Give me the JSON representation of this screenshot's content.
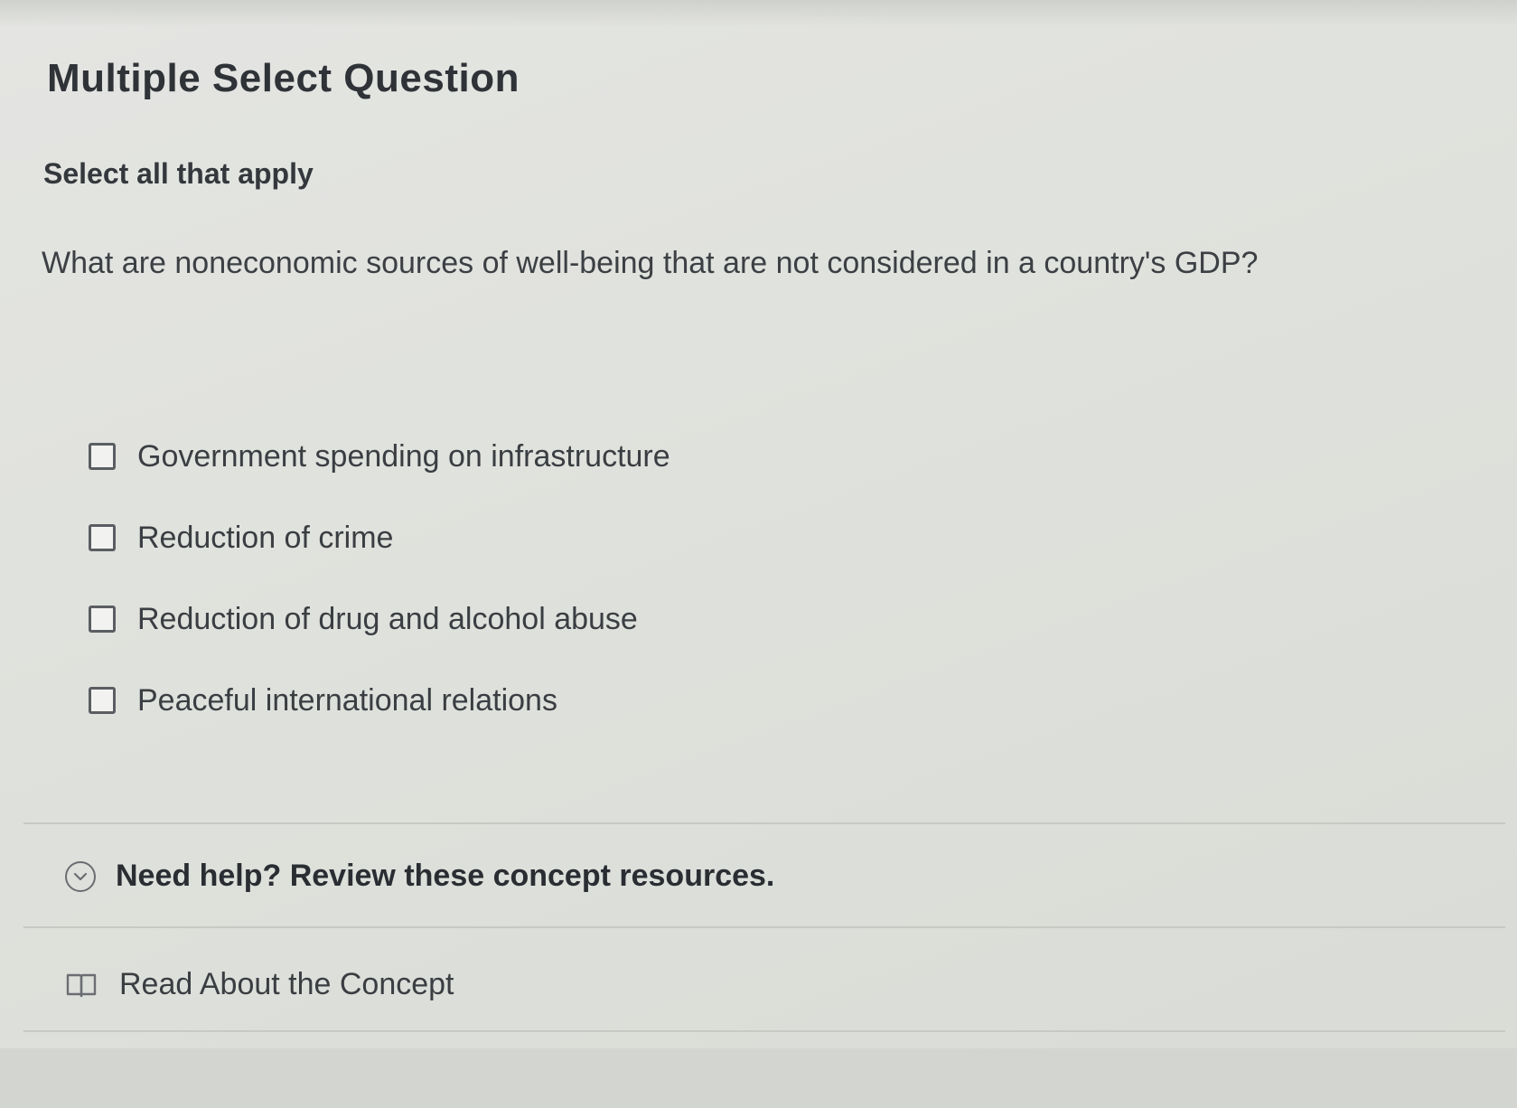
{
  "question": {
    "type_label": "Multiple Select Question",
    "instruction": "Select all that apply",
    "prompt": "What are noneconomic sources of well-being that are not considered in a country's GDP?"
  },
  "options": [
    {
      "label": "Government spending on infrastructure",
      "checked": false
    },
    {
      "label": "Reduction of crime",
      "checked": false
    },
    {
      "label": "Reduction of drug and alcohol abuse",
      "checked": false
    },
    {
      "label": "Peaceful international relations",
      "checked": false
    }
  ],
  "help": {
    "toggle_label": "Need help? Review these concept resources.",
    "toggle_icon": "chevron-down-circle-icon",
    "resource_label": "Read About the Concept",
    "resource_icon": "book-icon"
  }
}
